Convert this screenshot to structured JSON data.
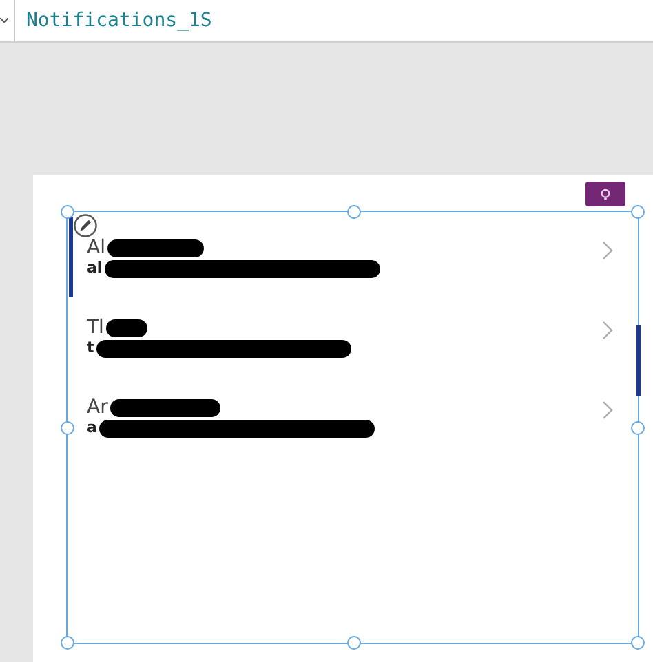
{
  "formula_bar": {
    "control_name": "Notifications_1S"
  },
  "list": {
    "items": [
      {
        "title": "Al",
        "subtitle": "al",
        "selected": true
      },
      {
        "title": "Tl",
        "subtitle": "t",
        "selected": false
      },
      {
        "title": "Ar",
        "subtitle": "a",
        "selected": false
      }
    ]
  }
}
